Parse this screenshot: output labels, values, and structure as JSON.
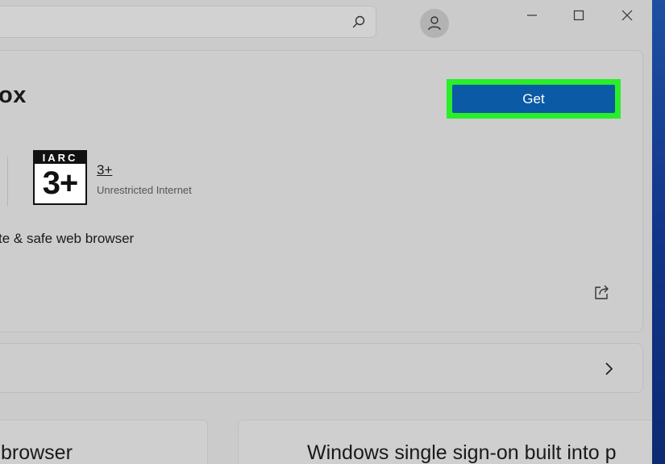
{
  "header": {
    "search": {
      "value": "",
      "icon": "search-icon"
    },
    "account": {
      "icon": "person-icon"
    },
    "window_controls": {
      "minimize": "minimize-icon",
      "maximize": "maximize-icon",
      "close": "close-icon"
    }
  },
  "app": {
    "title_fragment": "ox",
    "get_label": "Get",
    "rating": {
      "badge_top": "IARC",
      "badge_age": "3+",
      "age": "3+",
      "description": "Unrestricted Internet"
    },
    "tagline": "te & safe web browser"
  },
  "features": [
    {
      "title": "browser"
    },
    {
      "title": "Windows single sign-on built into p"
    }
  ],
  "colors": {
    "accent": "#0a5aa6",
    "highlight": "#2aee2a",
    "background": "#cbcbcb"
  }
}
